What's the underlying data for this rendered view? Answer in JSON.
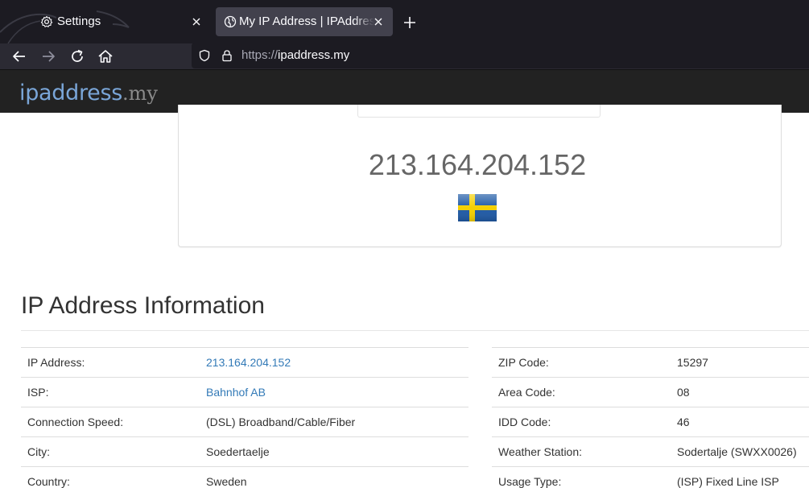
{
  "browser": {
    "tabs": [
      {
        "title": "Settings",
        "icon": "gear-icon",
        "active": false
      },
      {
        "title": "My IP Address | IPAddress.my",
        "icon": "globe-icon",
        "active": true
      }
    ],
    "url_scheme": "https://",
    "url_host": "ipaddress.my"
  },
  "site": {
    "logo_main": "ipaddress",
    "logo_tld": ".my"
  },
  "hero": {
    "ip": "213.164.204.152",
    "flag": "Sweden"
  },
  "info": {
    "title": "IP Address Information",
    "left": [
      {
        "label": "IP Address:",
        "value": "213.164.204.152",
        "link": true
      },
      {
        "label": "ISP:",
        "value": "Bahnhof AB",
        "link": true
      },
      {
        "label": "Connection Speed:",
        "value": "(DSL) Broadband/Cable/Fiber",
        "link": false
      },
      {
        "label": "City:",
        "value": "Soedertaelje",
        "link": false
      },
      {
        "label": "Country:",
        "value": "Sweden",
        "link": false
      }
    ],
    "right": [
      {
        "label": "ZIP Code:",
        "value": "15297"
      },
      {
        "label": "Area Code:",
        "value": "08"
      },
      {
        "label": "IDD Code:",
        "value": "46"
      },
      {
        "label": "Weather Station:",
        "value": "Sodertalje (SWXX0026)"
      },
      {
        "label": "Usage Type:",
        "value": "(ISP) Fixed Line ISP"
      }
    ]
  },
  "colors": {
    "link": "#337ab7",
    "logo": "#7aa6d8",
    "header_bg": "#222222",
    "flag_blue": "#1f5aa6",
    "flag_yellow": "#f5d000"
  }
}
